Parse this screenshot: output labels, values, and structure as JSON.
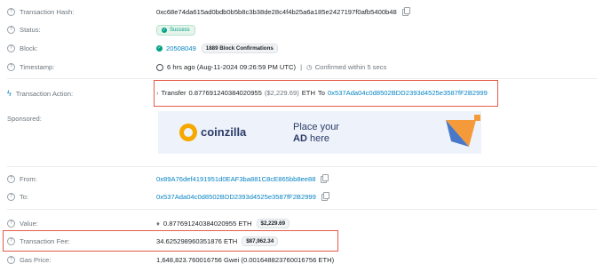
{
  "fields": {
    "tx_hash": {
      "label": "Transaction Hash:",
      "value": "0xc68e74da615ad0bdb0b5b8c3b38de28c4f4b25a6a185e2427197f0afb5400b48"
    },
    "status": {
      "label": "Status:",
      "value": "Success"
    },
    "block": {
      "label": "Block:",
      "number": "20508049",
      "confirmations": "1889 Block Confirmations"
    },
    "timestamp": {
      "label": "Timestamp:",
      "ago": "6 hrs ago (Aug-11-2024 09:26:59 PM UTC)",
      "separator": "|",
      "confirmed": "Confirmed within 5 secs"
    },
    "tx_action": {
      "label": "Transaction Action:",
      "arrow": "›",
      "verb": "Transfer",
      "amount": "0.877691240384020955",
      "usd": "($2,229.69)",
      "token": "ETH",
      "to_word": "To",
      "to_address": "0x537Ada04c0d8502BDD2393d4525e3587fF2B2999"
    },
    "sponsored": {
      "label": "Sponsored:",
      "brand": "coinzilla",
      "ad_line1": "Place your",
      "ad_line2a": "AD",
      "ad_line2b": "here"
    },
    "from": {
      "label": "From:",
      "value": "0x89A76def4191951d0EAF3ba881C8cE865bb8ee88"
    },
    "to": {
      "label": "To:",
      "value": "0x537Ada04c0d8502BDD2393d4525e3587fF2B2999"
    },
    "value": {
      "label": "Value:",
      "eth_symbol": "♦",
      "amount": "0.877691240384020955 ETH",
      "usd": "$2,229.69"
    },
    "tx_fee": {
      "label": "Transaction Fee:",
      "amount": "34.625298960351876 ETH",
      "usd": "$87,962.34"
    },
    "gas_price": {
      "label": "Gas Price:",
      "value": "1,648,823.760016756 Gwei (0.001648823760016756 ETH)"
    }
  },
  "icons": {
    "help": "question-circle-icon",
    "copy": "copy-icon",
    "check": "check-circle-icon",
    "clock": "clock-icon",
    "lightning": "lightning-icon"
  },
  "colors": {
    "link": "#0784c3",
    "success": "#00a186",
    "highlight_border": "#e35d4a"
  }
}
